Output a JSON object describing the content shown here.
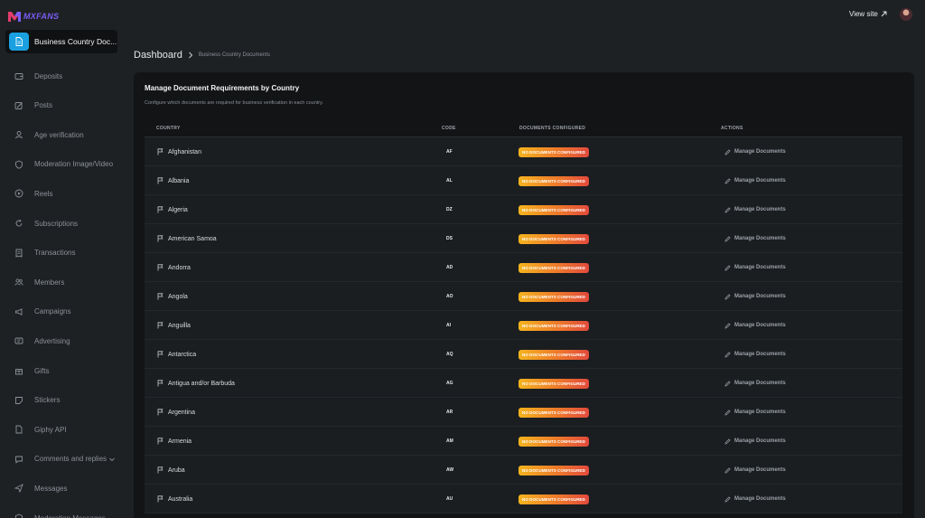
{
  "brand": {
    "logo_text": "MXFANS",
    "accent": "#7b5cf5"
  },
  "sidebar": {
    "active": {
      "label": "Business Country Doc...",
      "icon": "document-icon",
      "color": "#1aa0e0"
    },
    "items": [
      {
        "label": "Deposits",
        "icon": "wallet-icon"
      },
      {
        "label": "Posts",
        "icon": "edit-square-icon"
      },
      {
        "label": "Age verification",
        "icon": "user-id-icon"
      },
      {
        "label": "Moderation Image/Video",
        "icon": "shield-icon"
      },
      {
        "label": "Reels",
        "icon": "play-circle-icon"
      },
      {
        "label": "Subscriptions",
        "icon": "refresh-icon"
      },
      {
        "label": "Transactions",
        "icon": "receipt-icon"
      },
      {
        "label": "Members",
        "icon": "users-icon"
      },
      {
        "label": "Campaigns",
        "icon": "megaphone-icon"
      },
      {
        "label": "Advertising",
        "icon": "ad-icon"
      },
      {
        "label": "Gifts",
        "icon": "gift-icon"
      },
      {
        "label": "Stickers",
        "icon": "sticker-icon"
      },
      {
        "label": "Giphy API",
        "icon": "gif-icon"
      },
      {
        "label": "Comments and replies",
        "icon": "comment-icon",
        "has_caret": true
      },
      {
        "label": "Messages",
        "icon": "send-icon"
      },
      {
        "label": "Moderation Messages",
        "icon": "shield-icon"
      }
    ]
  },
  "header": {
    "view_site_label": "View site"
  },
  "breadcrumb": {
    "home": "Dashboard",
    "current": "Business Country Documents"
  },
  "card": {
    "title": "Manage Document Requirements by Country",
    "subtitle": "Configure which documents are required for business verification in each country."
  },
  "table": {
    "headers": {
      "country": "COUNTRY",
      "code": "CODE",
      "documents": "DOCUMENTS CONFIGURED",
      "actions": "ACTIONS"
    },
    "rows": [
      {
        "country": "Afghanistan",
        "code": "AF",
        "status": "NO DOCUMENTS CONFIGURED",
        "action": "Manage Documents"
      },
      {
        "country": "Albania",
        "code": "AL",
        "status": "NO DOCUMENTS CONFIGURED",
        "action": "Manage Documents"
      },
      {
        "country": "Algeria",
        "code": "DZ",
        "status": "NO DOCUMENTS CONFIGURED",
        "action": "Manage Documents"
      },
      {
        "country": "American Samoa",
        "code": "DS",
        "status": "NO DOCUMENTS CONFIGURED",
        "action": "Manage Documents"
      },
      {
        "country": "Andorra",
        "code": "AD",
        "status": "NO DOCUMENTS CONFIGURED",
        "action": "Manage Documents"
      },
      {
        "country": "Angola",
        "code": "AO",
        "status": "NO DOCUMENTS CONFIGURED",
        "action": "Manage Documents"
      },
      {
        "country": "Anguilla",
        "code": "AI",
        "status": "NO DOCUMENTS CONFIGURED",
        "action": "Manage Documents"
      },
      {
        "country": "Antarctica",
        "code": "AQ",
        "status": "NO DOCUMENTS CONFIGURED",
        "action": "Manage Documents"
      },
      {
        "country": "Antigua and/or Barbuda",
        "code": "AG",
        "status": "NO DOCUMENTS CONFIGURED",
        "action": "Manage Documents"
      },
      {
        "country": "Argentina",
        "code": "AR",
        "status": "NO DOCUMENTS CONFIGURED",
        "action": "Manage Documents"
      },
      {
        "country": "Armenia",
        "code": "AM",
        "status": "NO DOCUMENTS CONFIGURED",
        "action": "Manage Documents"
      },
      {
        "country": "Aruba",
        "code": "AW",
        "status": "NO DOCUMENTS CONFIGURED",
        "action": "Manage Documents"
      },
      {
        "country": "Australia",
        "code": "AU",
        "status": "NO DOCUMENTS CONFIGURED",
        "action": "Manage Documents"
      }
    ]
  }
}
